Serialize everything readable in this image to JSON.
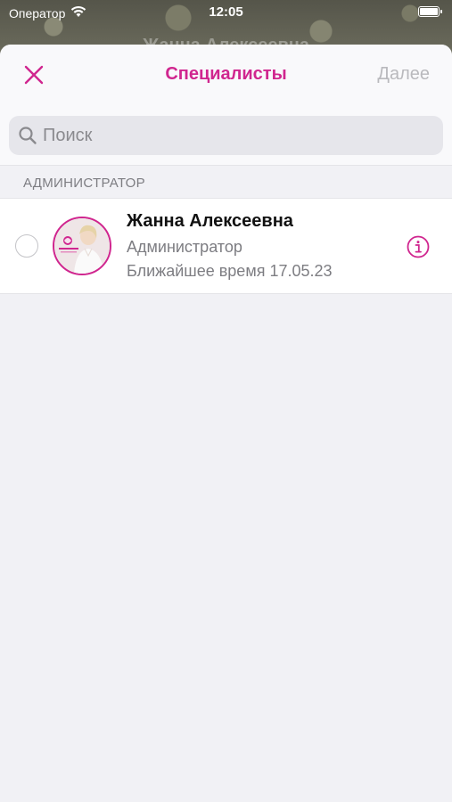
{
  "status_bar": {
    "carrier": "Оператор",
    "time": "12:05"
  },
  "background_title": "Жанна Алексеевна",
  "nav": {
    "title": "Специалисты",
    "next_label": "Далее"
  },
  "search": {
    "placeholder": "Поиск",
    "value": ""
  },
  "sections": [
    {
      "header": "АДМИНИСТРАТОР",
      "items": [
        {
          "name": "Жанна Алексеевна",
          "role": "Администратор",
          "nearest_time": "Ближайшее время 17.05.23",
          "selected": false
        }
      ]
    }
  ],
  "colors": {
    "accent": "#d0268f",
    "disabled": "#b9b9bd",
    "background": "#f1f1f5"
  },
  "icons": [
    "wifi-icon",
    "battery-icon",
    "close-icon",
    "search-icon",
    "radio-icon",
    "info-icon"
  ]
}
